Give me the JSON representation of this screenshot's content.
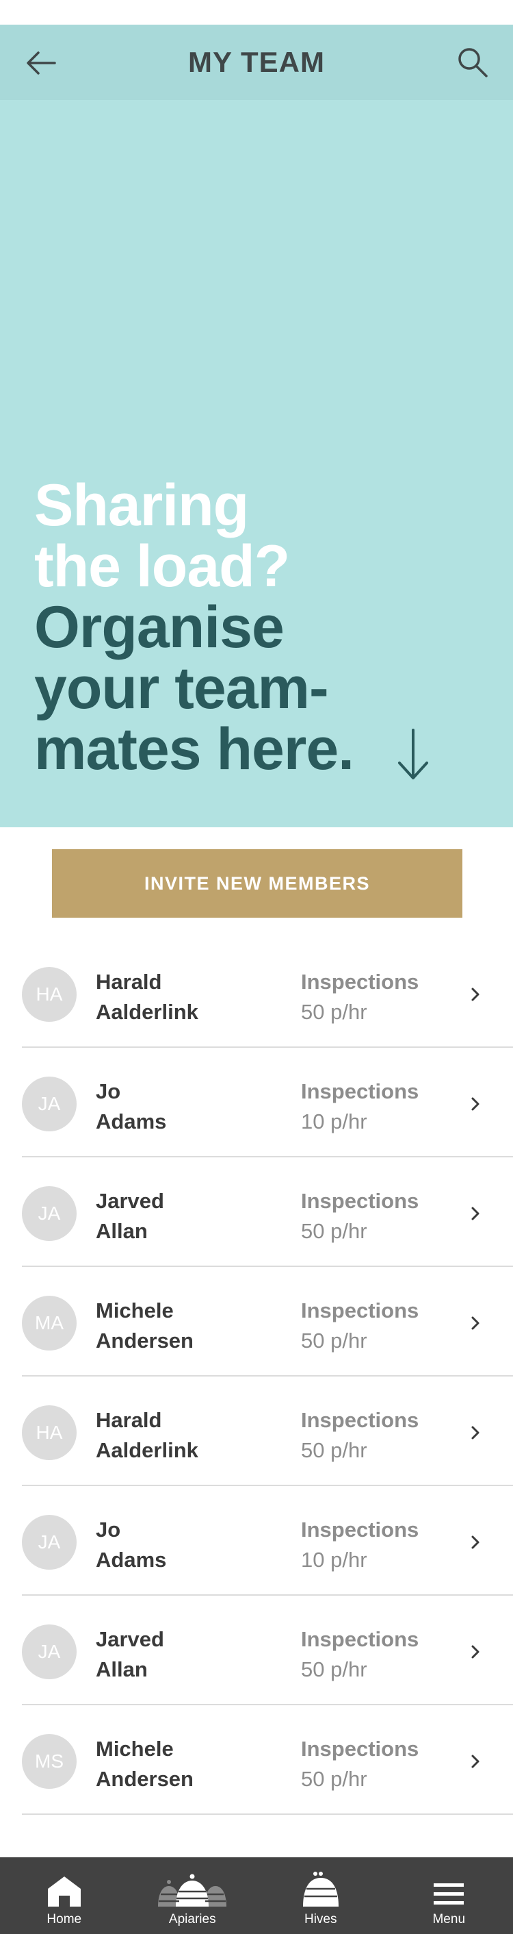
{
  "header": {
    "title": "MY TEAM",
    "back_icon": "back-arrow-icon",
    "search_icon": "search-icon"
  },
  "hero": {
    "line1": "Sharing",
    "line2": "the load?",
    "line3": "Organise",
    "line4": "your team-",
    "line5": "mates here.",
    "arrow_icon": "arrow-down-icon",
    "bg_color": "#b2e2e1",
    "light_text_color": "#ffffff",
    "dark_text_color": "#2a5a5c"
  },
  "invite": {
    "label": "INVITE NEW MEMBERS",
    "color": "#bfa36c"
  },
  "members": [
    {
      "initials": "HA",
      "first": "Harald",
      "last": "Aalderlink",
      "stat_label": "Inspections",
      "rate": "50 p/hr"
    },
    {
      "initials": "JA",
      "first": "Jo",
      "last": "Adams",
      "stat_label": "Inspections",
      "rate": "10 p/hr"
    },
    {
      "initials": "JA",
      "first": "Jarved",
      "last": "Allan",
      "stat_label": "Inspections",
      "rate": "50 p/hr"
    },
    {
      "initials": "MA",
      "first": "Michele",
      "last": "Andersen",
      "stat_label": "Inspections",
      "rate": "50 p/hr"
    },
    {
      "initials": "HA",
      "first": "Harald",
      "last": "Aalderlink",
      "stat_label": "Inspections",
      "rate": "50 p/hr"
    },
    {
      "initials": "JA",
      "first": "Jo",
      "last": "Adams",
      "stat_label": "Inspections",
      "rate": "10 p/hr"
    },
    {
      "initials": "JA",
      "first": "Jarved",
      "last": "Allan",
      "stat_label": "Inspections",
      "rate": "50 p/hr"
    },
    {
      "initials": "MS",
      "first": "Michele",
      "last": "Andersen",
      "stat_label": "Inspections",
      "rate": "50 p/hr"
    }
  ],
  "nav": {
    "home": "Home",
    "apiaries": "Apiaries",
    "hives": "Hives",
    "menu": "Menu"
  }
}
